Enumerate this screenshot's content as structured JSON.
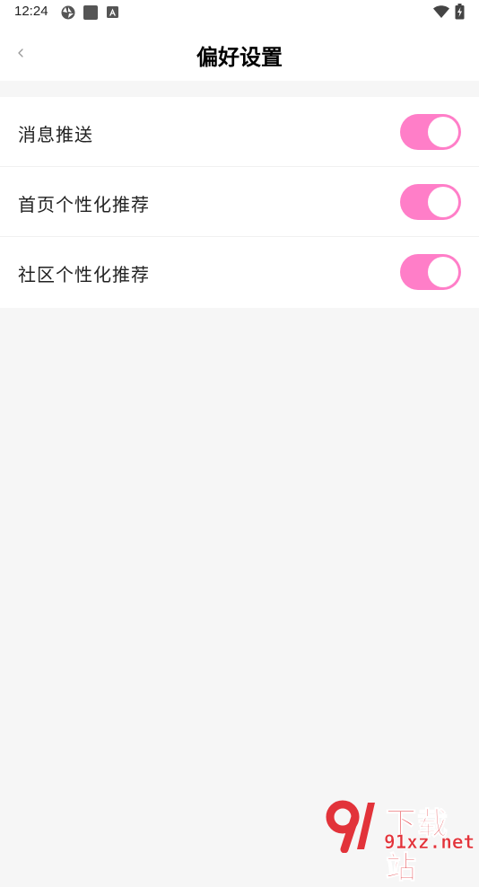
{
  "status_bar": {
    "time": "12:24",
    "icons": [
      "sync-icon",
      "app-square-icon",
      "notification-a-icon",
      "wifi-icon",
      "battery-icon"
    ]
  },
  "header": {
    "title": "偏好设置",
    "back_icon": "chevron-left-icon"
  },
  "settings": [
    {
      "label": "消息推送",
      "enabled": true
    },
    {
      "label": "首页个性化推荐",
      "enabled": true
    },
    {
      "label": "社区个性化推荐",
      "enabled": true
    }
  ],
  "colors": {
    "accent": "#ff7ec8",
    "background": "#f6f6f6",
    "surface": "#ffffff"
  },
  "watermark": {
    "line1": "下载站",
    "line2": "91xz.net"
  }
}
